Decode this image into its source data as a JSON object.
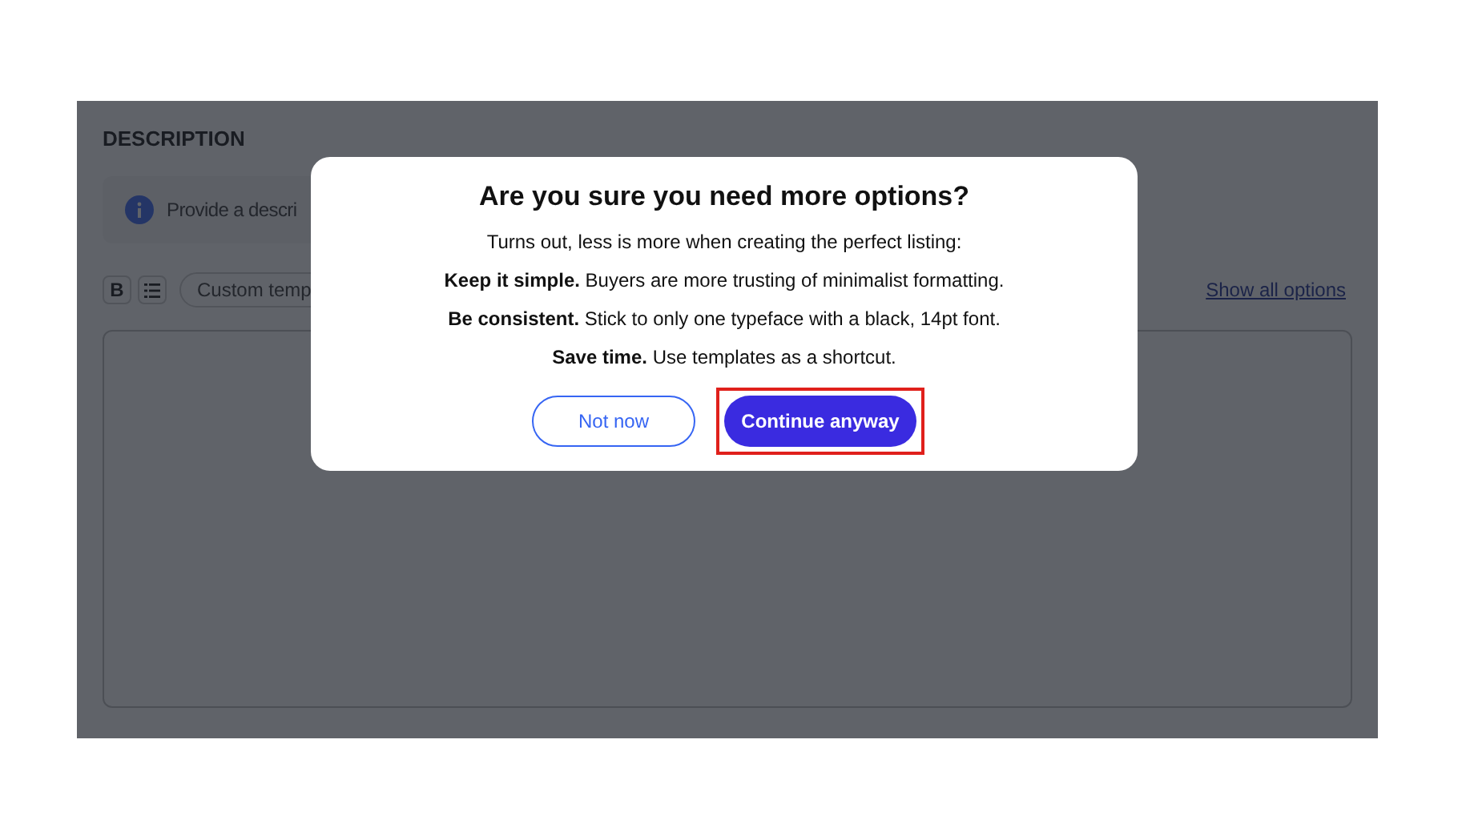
{
  "section": {
    "title": "DESCRIPTION",
    "info_text": "Provide a descri",
    "toolbar": {
      "bold": "B",
      "template_dropdown": "Custom temp",
      "show_all_link": "Show all options"
    }
  },
  "dialog": {
    "title": "Are you sure you need more options?",
    "paragraphs": [
      "Turns out, less is more when creating the perfect listing:",
      "**Keep it simple.** Buyers are more trusting of minimalist formatting.",
      "**Be consistent.** Stick to only one typeface with a black, 14pt font.",
      "**Save time.** Use templates as a shortcut."
    ],
    "buttons": [
      {
        "label": "Not now",
        "kind": "secondary",
        "highlighted": false
      },
      {
        "label": "Continue anyway",
        "kind": "primary",
        "highlighted": true
      }
    ]
  }
}
